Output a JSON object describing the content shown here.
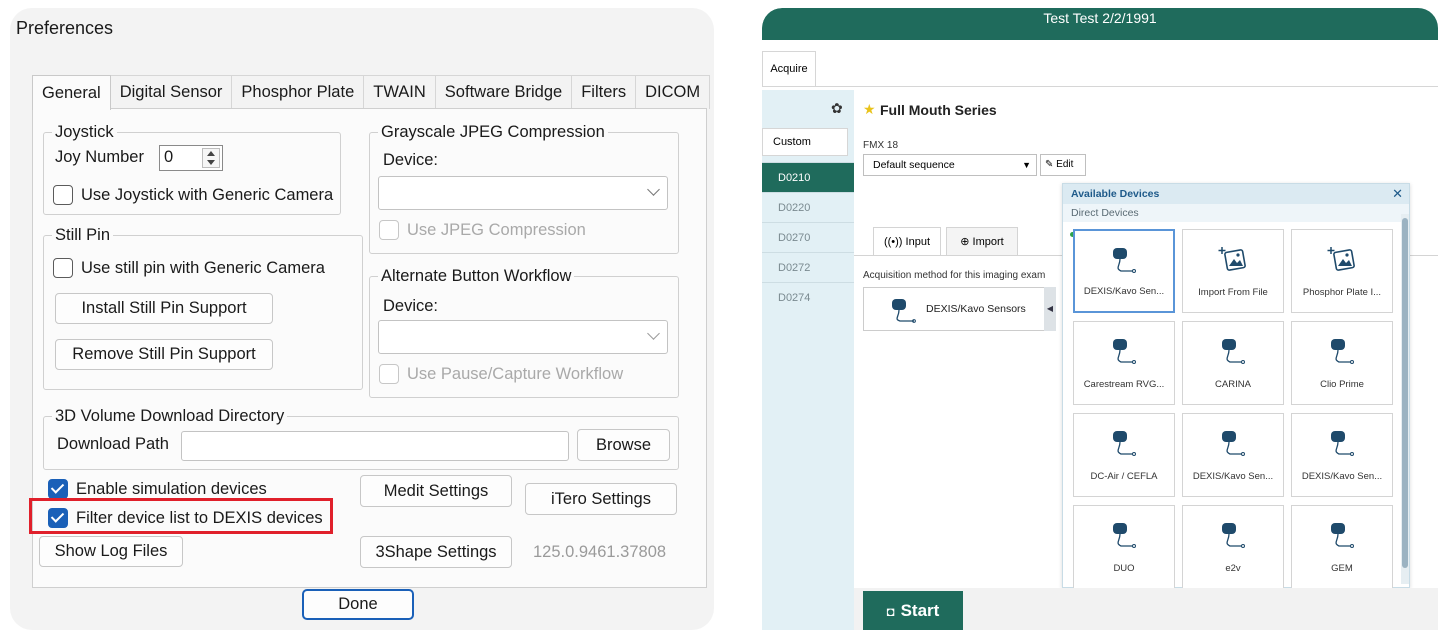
{
  "prefs": {
    "window_title": "Preferences",
    "tabs": [
      "General",
      "Digital Sensor",
      "Phosphor Plate",
      "TWAIN",
      "Software Bridge",
      "Filters",
      "DICOM"
    ],
    "joystick": {
      "group_title": "Joystick",
      "joy_number_label": "Joy Number",
      "joy_number_value": "0",
      "use_generic_camera": "Use Joystick with Generic Camera"
    },
    "still_pin": {
      "group_title": "Still Pin",
      "use_generic_camera": "Use still pin with Generic Camera",
      "install_button": "Install Still Pin Support",
      "remove_button": "Remove Still Pin Support"
    },
    "grayscale": {
      "group_title": "Grayscale JPEG Compression",
      "device_label": "Device:",
      "use_jpeg": "Use JPEG Compression"
    },
    "alternate": {
      "group_title": "Alternate Button Workflow",
      "device_label": "Device:",
      "use_pause": "Use Pause/Capture Workflow"
    },
    "volume": {
      "group_title": "3D Volume Download Directory",
      "download_path_label": "Download Path",
      "download_path_value": "",
      "browse_button": "Browse"
    },
    "enable_simulation": "Enable simulation devices",
    "filter_dexis": "Filter device list to DEXIS devices",
    "medit_button": "Medit Settings",
    "itero_button": "iTero Settings",
    "show_log_button": "Show Log Files",
    "shape_button": "3Shape Settings",
    "version": "125.0.9461.37808",
    "done_button": "Done"
  },
  "app": {
    "header_title": "Test Test 2/2/1991",
    "tab_acquire": "Acquire",
    "custom_label": "Custom",
    "codes": [
      "D0210",
      "D0220",
      "D0270",
      "D0272",
      "D0274"
    ],
    "series_title": "Full Mouth Series",
    "fmx_label": "FMX 18",
    "sequence_value": "Default sequence",
    "edit_label": "Edit",
    "input_tab": "Input",
    "import_tab": "Import",
    "acq_label": "Acquisition method for this imaging exam",
    "sensor_button": "DEXIS/Kavo Sensors",
    "start_button": "Start",
    "devices_panel": {
      "title": "Available Devices",
      "subtitle": "Direct Devices",
      "tiles": [
        "DEXIS/Kavo Sen...",
        "Import From File",
        "Phosphor Plate I...",
        "Carestream RVG...",
        "CARINA",
        "Clio Prime",
        "DC-Air / CEFLA",
        "DEXIS/Kavo Sen...",
        "DEXIS/Kavo Sen...",
        "DUO",
        "e2v",
        "GEM"
      ]
    }
  }
}
